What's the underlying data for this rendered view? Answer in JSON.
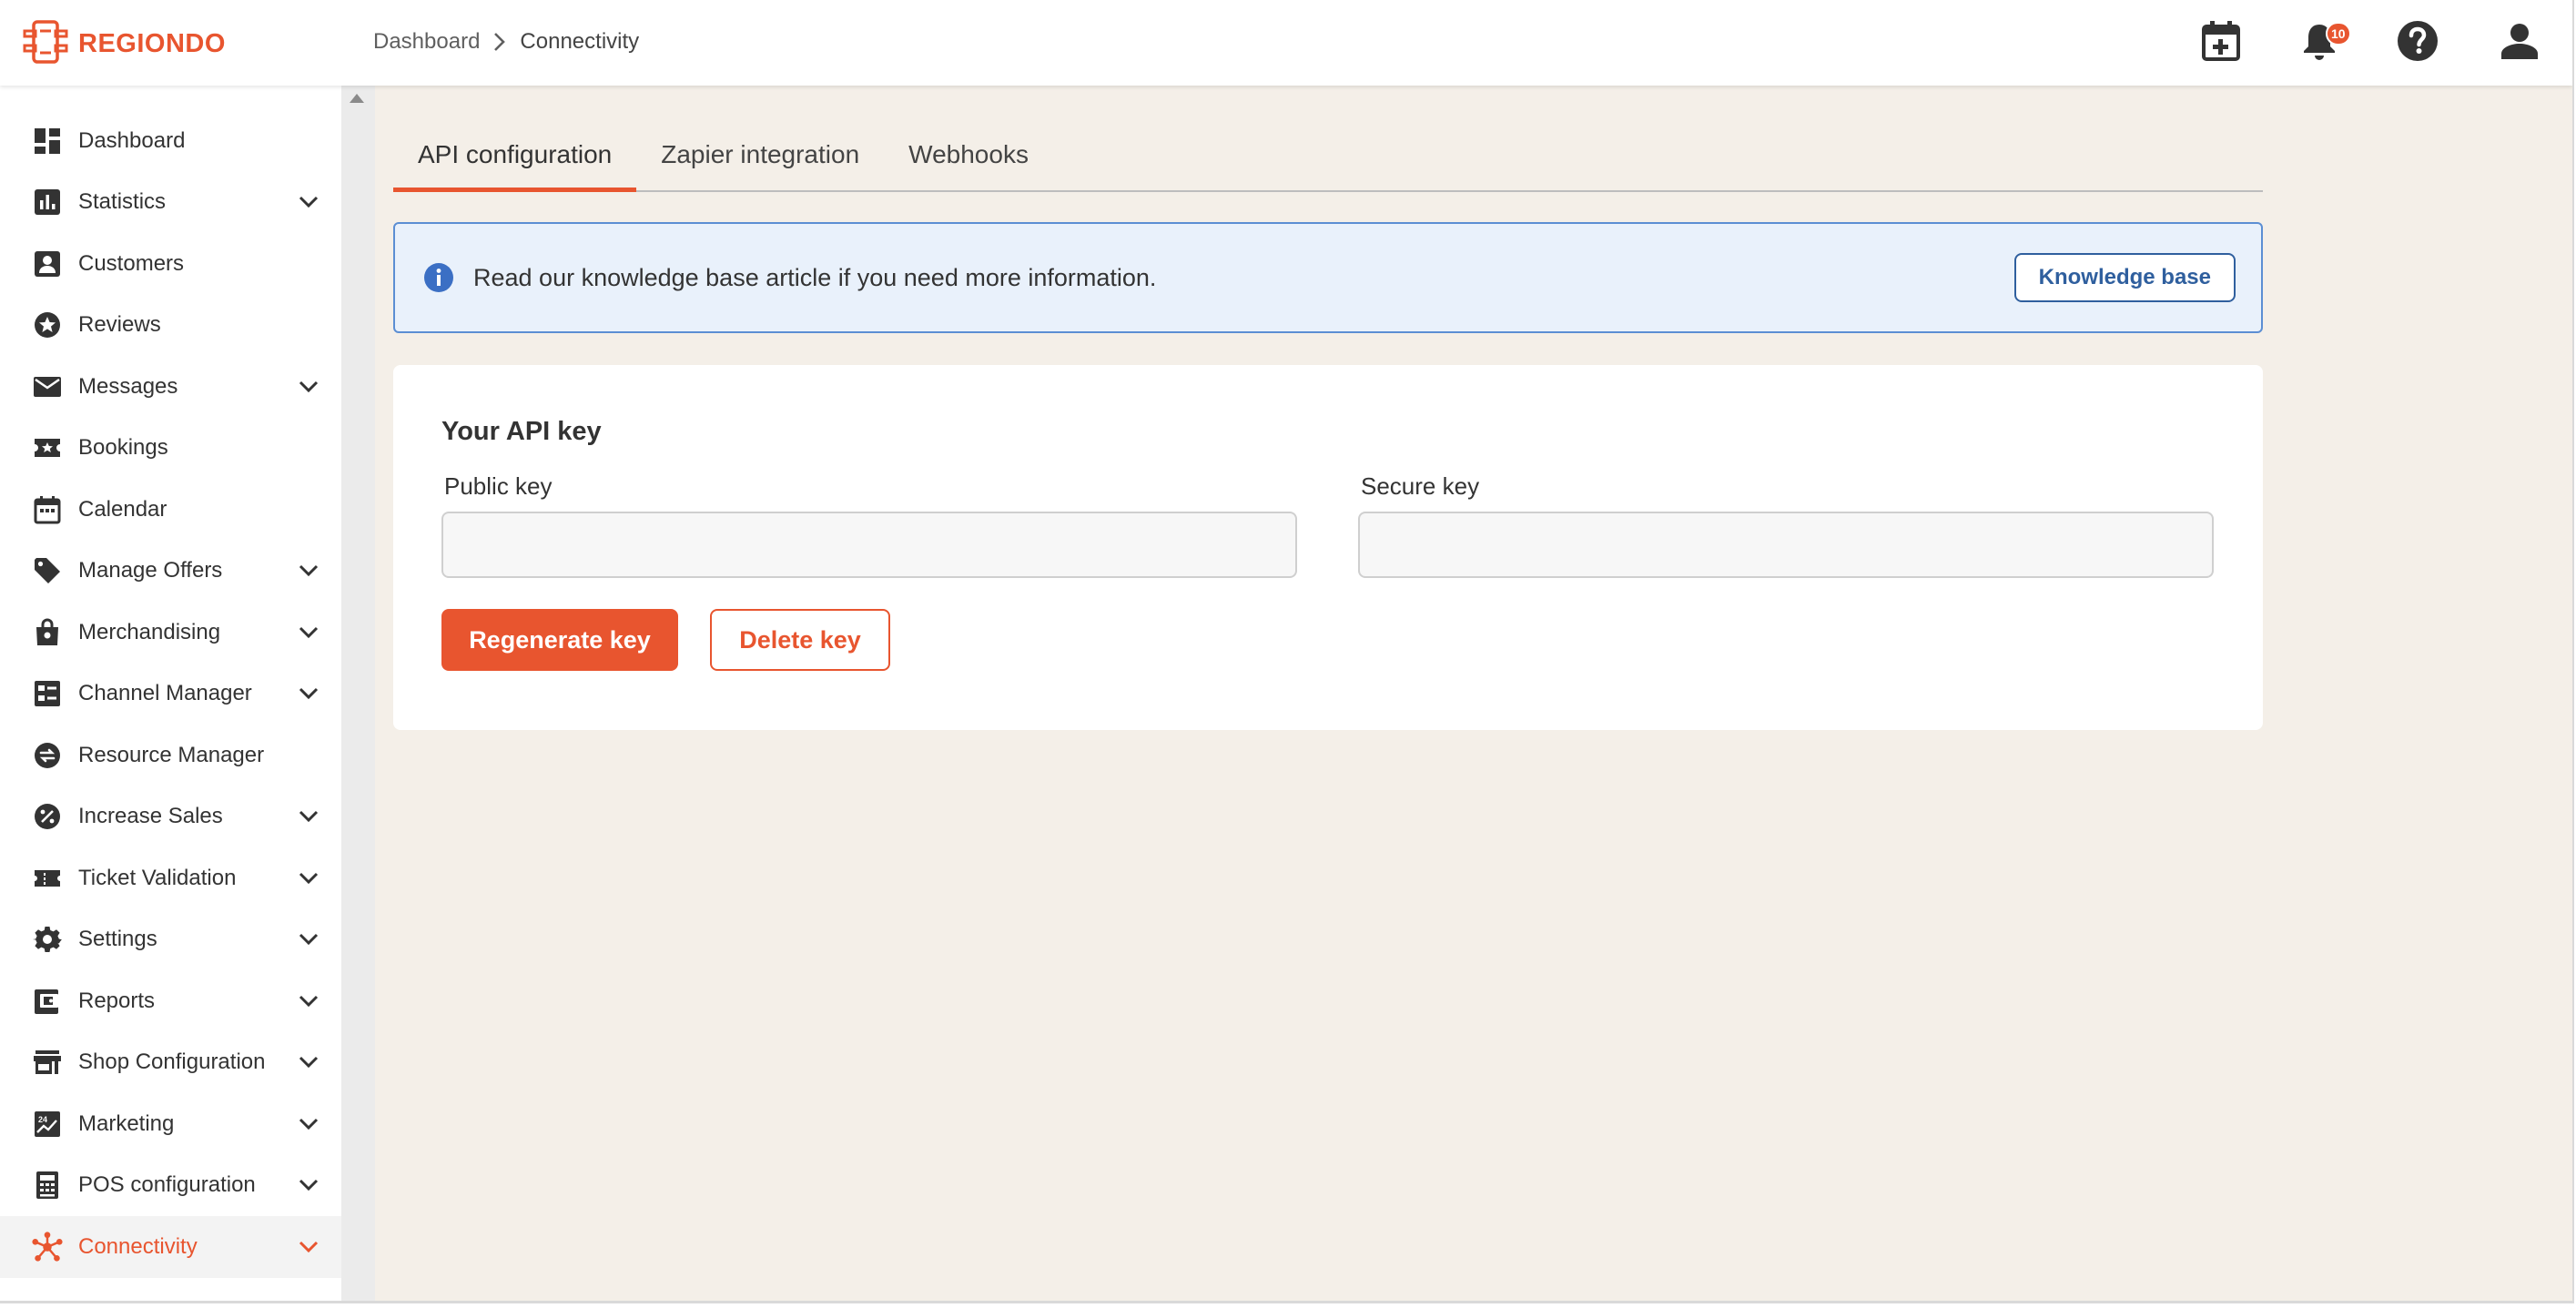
{
  "brand": {
    "name": "REGIONDO",
    "accent_color": "#e8552f",
    "link_color": "#2f5f9e",
    "info_bg": "#e9f1fb"
  },
  "header": {
    "breadcrumb": [
      {
        "label": "Dashboard"
      },
      {
        "label": "Connectivity"
      }
    ],
    "actions": [
      {
        "icon": "calendar-add-icon"
      },
      {
        "icon": "bell-icon",
        "badge": "10"
      },
      {
        "icon": "help-icon"
      },
      {
        "icon": "user-icon"
      }
    ]
  },
  "sidebar": {
    "items": [
      {
        "label": "Dashboard",
        "icon": "dashboard-icon",
        "expandable": false
      },
      {
        "label": "Statistics",
        "icon": "statistics-icon",
        "expandable": true
      },
      {
        "label": "Customers",
        "icon": "customers-icon",
        "expandable": false
      },
      {
        "label": "Reviews",
        "icon": "reviews-icon",
        "expandable": false
      },
      {
        "label": "Messages",
        "icon": "mail-icon",
        "expandable": true
      },
      {
        "label": "Bookings",
        "icon": "bookings-icon",
        "expandable": false
      },
      {
        "label": "Calendar",
        "icon": "calendar-icon",
        "expandable": false
      },
      {
        "label": "Manage Offers",
        "icon": "tag-icon",
        "expandable": true
      },
      {
        "label": "Merchandising",
        "icon": "shopping-bag-icon",
        "expandable": true
      },
      {
        "label": "Channel Manager",
        "icon": "channel-manager-icon",
        "expandable": true
      },
      {
        "label": "Resource Manager",
        "icon": "resource-manager-icon",
        "expandable": false
      },
      {
        "label": "Increase Sales",
        "icon": "percent-icon",
        "expandable": true
      },
      {
        "label": "Ticket Validation",
        "icon": "ticket-icon",
        "expandable": true
      },
      {
        "label": "Settings",
        "icon": "gear-icon",
        "expandable": true
      },
      {
        "label": "Reports",
        "icon": "reports-icon",
        "expandable": true
      },
      {
        "label": "Shop Configuration",
        "icon": "store-icon",
        "expandable": true
      },
      {
        "label": "Marketing",
        "icon": "marketing-icon",
        "expandable": true
      },
      {
        "label": "POS configuration",
        "icon": "pos-icon",
        "expandable": true
      },
      {
        "label": "Connectivity",
        "icon": "connectivity-icon",
        "expandable": true,
        "active": true
      }
    ]
  },
  "main": {
    "tabs": [
      {
        "label": "API configuration",
        "active": true
      },
      {
        "label": "Zapier integration",
        "active": false
      },
      {
        "label": "Webhooks",
        "active": false
      }
    ],
    "info_banner": {
      "icon": "info-icon",
      "text": "Read our knowledge base article if you need more information.",
      "button_label": "Knowledge base"
    },
    "api_card": {
      "title": "Your API key",
      "public_key": {
        "label": "Public key",
        "value": ""
      },
      "secure_key": {
        "label": "Secure key",
        "value": ""
      },
      "regenerate_label": "Regenerate key",
      "delete_label": "Delete key"
    }
  }
}
